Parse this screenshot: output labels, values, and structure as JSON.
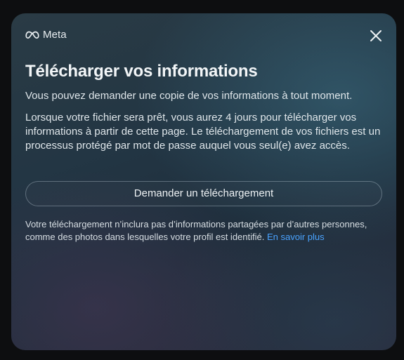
{
  "header": {
    "brand": "Meta",
    "logo_icon": "meta-infinity-icon",
    "close_icon": "close-icon"
  },
  "dialog": {
    "title": "Télécharger vos informations",
    "intro": "Vous pouvez demander une copie de vos informations à tout moment.",
    "details": "Lorsque votre fichier sera prêt, vous aurez 4 jours pour télécharger vos informations à partir de cette page. Le téléchargement de vos fichiers est un processus protégé par mot de passe auquel vous seul(e) avez accès.",
    "request_button_label": "Demander un téléchargement",
    "note": "Votre téléchargement n’inclura pas d’informations partagées par d’autres personnes, comme des photos dans lesquelles votre profil est identifié.",
    "learn_more_link": "En savoir plus"
  },
  "colors": {
    "link": "#4aa3ff",
    "text": "#dfe6ea",
    "title": "#f2f5f7"
  }
}
